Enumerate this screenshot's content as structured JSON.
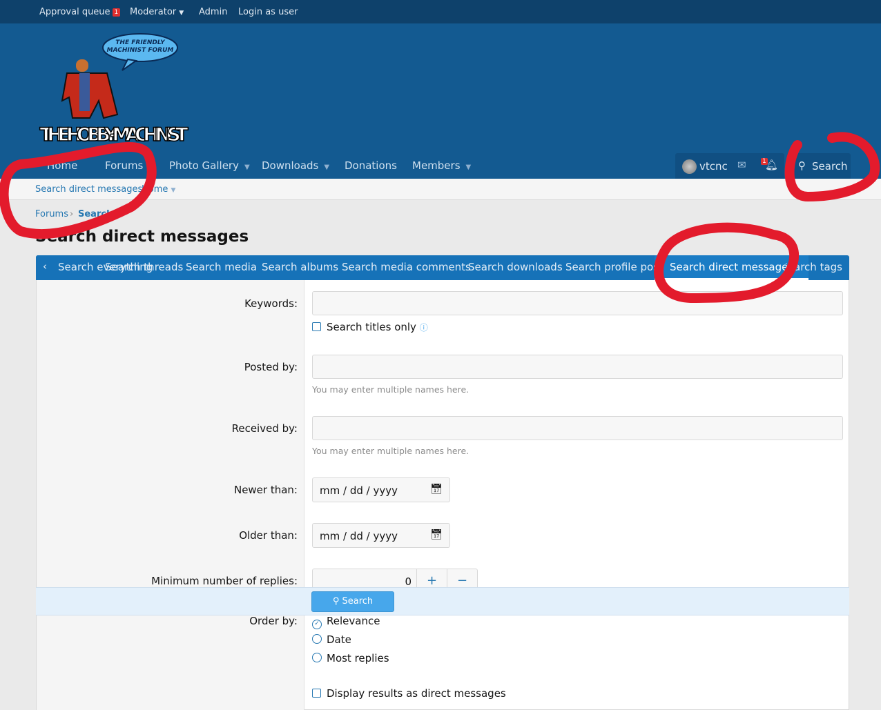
{
  "topbar": {
    "approval_queue": "Approval queue",
    "approval_count": "1",
    "moderator": "Moderator",
    "admin": "Admin",
    "login_as_user": "Login as user"
  },
  "logo": {
    "speech": "THE FRIENDLY MACHINIST FORUM",
    "name": "THE HOBBY-MACHINIST"
  },
  "nav": {
    "items": [
      {
        "label": "Home"
      },
      {
        "label": "Forums"
      },
      {
        "label": "Photo Gallery"
      },
      {
        "label": "Downloads"
      },
      {
        "label": "Donations"
      },
      {
        "label": "Members"
      }
    ],
    "username": "vtcnc",
    "alerts_count": "1",
    "search": "Search"
  },
  "subnav": {
    "items": [
      {
        "label": "Search direct messages"
      },
      {
        "label": "Home"
      }
    ]
  },
  "breadcrumb": {
    "items": [
      {
        "label": "Forums"
      },
      {
        "label": "Search"
      }
    ]
  },
  "page": {
    "title": "Search direct messages"
  },
  "tabs": [
    {
      "label": "Search everything"
    },
    {
      "label": "Search threads"
    },
    {
      "label": "Search media"
    },
    {
      "label": "Search albums"
    },
    {
      "label": "Search media comments"
    },
    {
      "label": "Search downloads"
    },
    {
      "label": "Search profile posts"
    },
    {
      "label": "Search direct messages",
      "active": true
    },
    {
      "label": "Search tags"
    }
  ],
  "form": {
    "keywords_label": "Keywords:",
    "keywords_value": "",
    "titles_only": "Search titles only",
    "posted_by_label": "Posted by:",
    "posted_by_hint": "You may enter multiple names here.",
    "received_by_label": "Received by:",
    "received_by_hint": "You may enter multiple names here.",
    "newer_than_label": "Newer than:",
    "newer_than_placeholder": "mm / dd / yyyy",
    "older_than_label": "Older than:",
    "older_than_placeholder": "mm / dd / yyyy",
    "min_replies_label": "Minimum number of replies:",
    "min_replies_value": "0",
    "order_by_label": "Order by:",
    "order_options": [
      {
        "label": "Relevance",
        "selected": true
      },
      {
        "label": "Date"
      },
      {
        "label": "Most replies"
      }
    ],
    "display_results": "Display results as direct messages",
    "search_button": "Search"
  },
  "colors": {
    "topbar": "#0e416b",
    "header": "#135a91",
    "tabs": "#1672b8",
    "annotation": "#e31b2c"
  }
}
